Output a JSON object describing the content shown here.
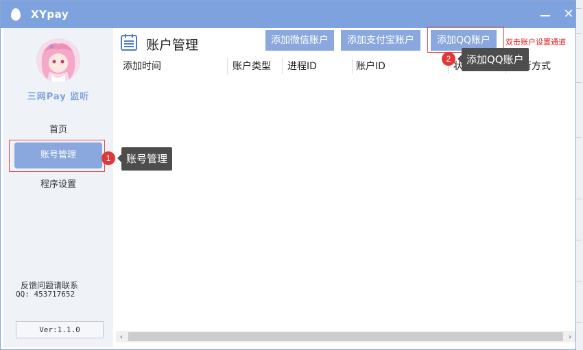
{
  "window": {
    "title": "XYpay",
    "minimize_icon": "minimize-icon",
    "close_icon": "close-icon",
    "close_glyph": "✕"
  },
  "sidebar": {
    "brand": "三网Pay 监听",
    "nav": [
      {
        "label": "首页"
      },
      {
        "label": "账号管理",
        "active": true
      },
      {
        "label": "程序设置"
      }
    ],
    "feedback_label": "反馈问题请联系",
    "qq_contact": "QQ: 453717652",
    "version": "Ver:1.1.0"
  },
  "main": {
    "title": "账户管理",
    "buttons": {
      "add_wechat": "添加微信账户",
      "add_alipay": "添加支付宝账户",
      "add_qq": "添加QQ账户"
    },
    "channel_hint": "双击账户设置通道",
    "columns": [
      "添加时间",
      "账户类型",
      "进程ID",
      "账户ID",
      "状态",
      "更新方式"
    ]
  },
  "annotations": [
    {
      "number": "1",
      "label": "账号管理"
    },
    {
      "number": "2",
      "label": "添加QQ账户"
    }
  ],
  "colors": {
    "accent": "#7ea2dd",
    "button": "#8aa8dd",
    "highlight": "#e04848",
    "tooltip_bg": "#4d4d4d"
  }
}
